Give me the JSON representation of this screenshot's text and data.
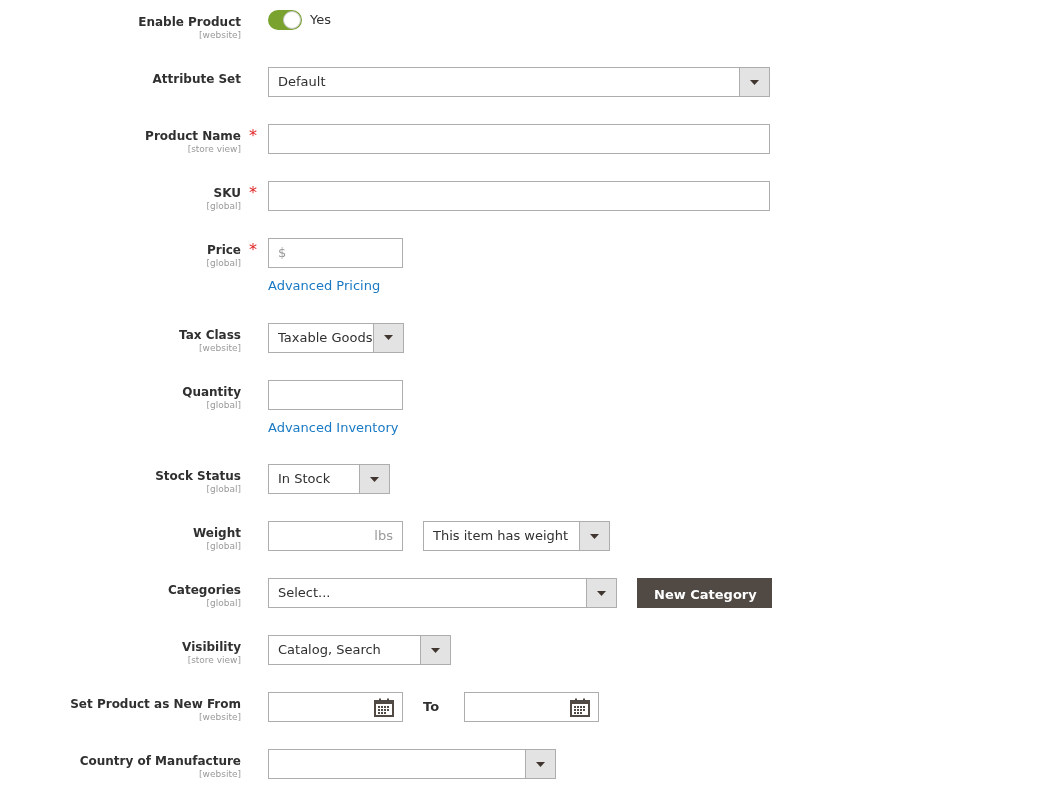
{
  "fields": [
    {
      "label": "Enable Product",
      "scope": "[website]",
      "controls": [
        {
          "kind": "toggle",
          "on": true,
          "text": "Yes"
        }
      ]
    },
    {
      "label": "Attribute Set",
      "controls": [
        {
          "kind": "select",
          "value": "Default"
        }
      ]
    },
    {
      "label": "Product Name",
      "scope": "[store view]",
      "required_mark": "*",
      "controls": [
        {
          "kind": "input"
        }
      ]
    },
    {
      "label": "SKU",
      "scope": "[global]",
      "required_mark": "*",
      "controls": [
        {
          "kind": "input"
        }
      ]
    },
    {
      "label": "Price",
      "scope": "[global]",
      "required_mark": "*",
      "controls": [
        {
          "kind": "input",
          "prefix": "$"
        }
      ],
      "link": "Advanced Pricing"
    },
    {
      "label": "Tax Class",
      "scope": "[website]",
      "controls": [
        {
          "kind": "select",
          "value": "Taxable Goods"
        }
      ]
    },
    {
      "label": "Quantity",
      "scope": "[global]",
      "controls": [
        {
          "kind": "input"
        }
      ],
      "link": "Advanced Inventory"
    },
    {
      "label": "Stock Status",
      "scope": "[global]",
      "controls": [
        {
          "kind": "select",
          "value": "In Stock"
        }
      ]
    },
    {
      "label": "Weight",
      "scope": "[global]",
      "controls": [
        {
          "kind": "input",
          "suffix": "lbs"
        },
        {
          "kind": "select",
          "value": "This item has weight"
        }
      ]
    },
    {
      "label": "Categories",
      "scope": "[global]",
      "controls": [
        {
          "kind": "select",
          "value": "Select..."
        },
        {
          "kind": "button",
          "text": "New Category"
        }
      ]
    },
    {
      "label": "Visibility",
      "scope": "[store view]",
      "controls": [
        {
          "kind": "select",
          "value": "Catalog, Search"
        }
      ]
    },
    {
      "label": "Set Product as New From",
      "scope": "[website]",
      "controls": [
        {
          "kind": "date"
        },
        {
          "kind": "text",
          "text": "To"
        },
        {
          "kind": "date"
        }
      ]
    },
    {
      "label": "Country of Manufacture",
      "scope": "[website]",
      "controls": [
        {
          "kind": "select"
        }
      ]
    }
  ]
}
